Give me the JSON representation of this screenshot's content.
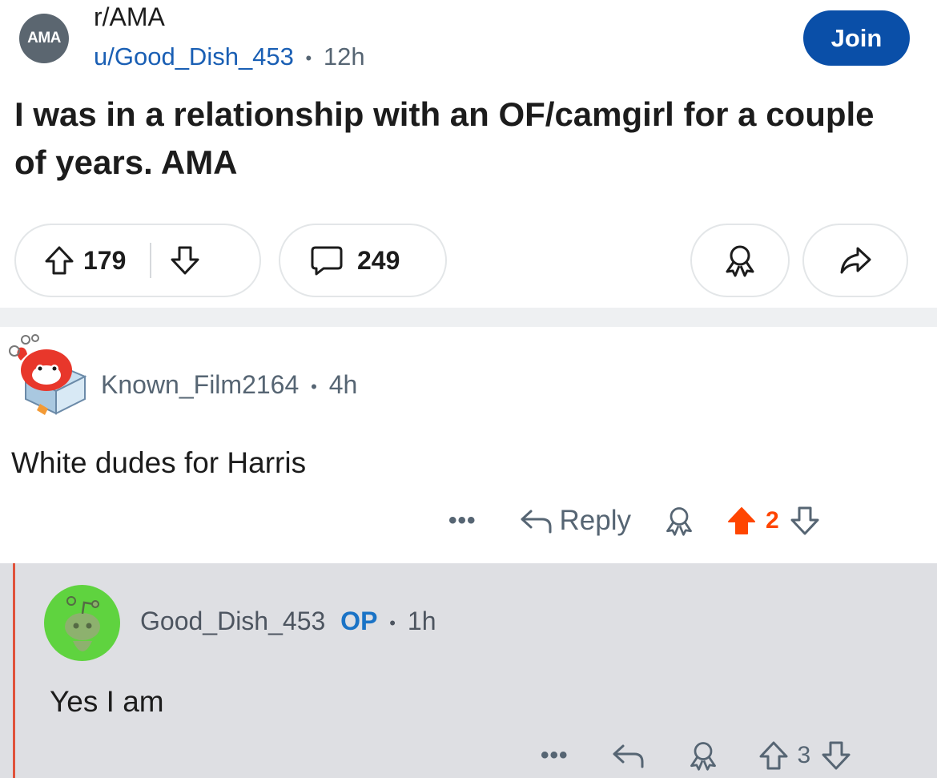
{
  "post": {
    "subreddit_avatar_text": "AMA",
    "subreddit": "r/AMA",
    "author": "u/Good_Dish_453",
    "separator": "•",
    "age": "12h",
    "join_label": "Join",
    "title": "I was in a relationship with an OF/camgirl for a couple of years. AMA",
    "score": "179",
    "comment_count": "249"
  },
  "comments": [
    {
      "author": "Known_Film2164",
      "separator": "•",
      "age": "4h",
      "body": "White dudes for Harris",
      "more": "•••",
      "reply_label": "Reply",
      "score": "2"
    },
    {
      "author": "Good_Dish_453",
      "op_badge": "OP",
      "separator": "•",
      "age": "1h",
      "body": "Yes I am",
      "more": "•••",
      "score": "3"
    }
  ],
  "colors": {
    "join_button": "#0a4fa8",
    "upvoted": "#ff4500",
    "op_badge": "#1a73c6",
    "thread_line": "#e0523b"
  },
  "icons": [
    "upvote-icon",
    "downvote-icon",
    "comment-icon",
    "award-icon",
    "share-icon",
    "reply-icon",
    "more-icon"
  ]
}
